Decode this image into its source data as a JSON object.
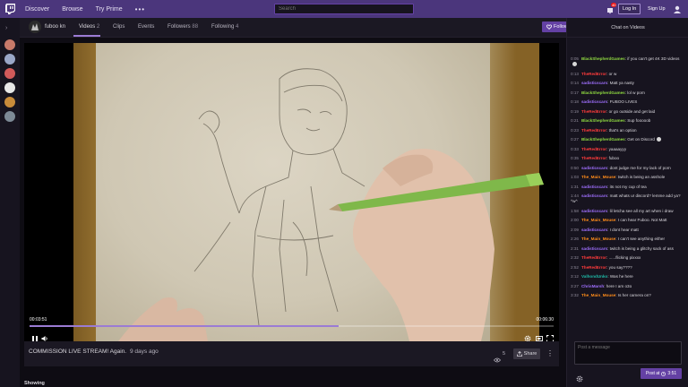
{
  "nav": {
    "items": [
      "Discover",
      "Browse",
      "Try Prime"
    ],
    "more": "•••",
    "search_placeholder": "Search",
    "notification_count": "40",
    "login": "Log In",
    "signup": "Sign Up"
  },
  "channel": {
    "name": "fuboo kn",
    "tabs": [
      {
        "label": "Videos",
        "count": "2"
      },
      {
        "label": "Clips",
        "count": ""
      },
      {
        "label": "Events",
        "count": ""
      },
      {
        "label": "Followers",
        "count": "88"
      },
      {
        "label": "Following",
        "count": "4"
      }
    ],
    "follow": "Follow"
  },
  "player": {
    "time_elapsed": "00:03:51",
    "time_total": "00:06:30",
    "progress": 0.59
  },
  "video": {
    "title": "COMMISSION LIVE STREAM! Again.",
    "age": "9 days ago",
    "views": "5",
    "share": "Share"
  },
  "showing": "Showing",
  "chat": {
    "header": "Chat on Videos",
    "placeholder": "Post a message",
    "post_label": "Post at",
    "post_time": "3:51",
    "messages": [
      {
        "time": "0:05",
        "user": "BlackShepherdGames",
        "color": "#8ed840",
        "text": ": if you can't get 4K 3D videos",
        "emote": true
      },
      {
        "time": "0:13",
        "user": "TheRedError",
        "color": "#ff3b3b",
        "text": ": or w",
        "emote": false
      },
      {
        "time": "0:14",
        "user": "sadisticscars",
        "color": "#a070ff",
        "text": ": Matt ya nasty",
        "emote": false
      },
      {
        "time": "0:17",
        "user": "BlackShepherdGames",
        "color": "#8ed840",
        "text": ": lol w porn",
        "emote": false
      },
      {
        "time": "0:18",
        "user": "sadisticscars",
        "color": "#a070ff",
        "text": ": FUBOO LIVES",
        "emote": false
      },
      {
        "time": "0:19",
        "user": "TheRedError",
        "color": "#ff3b3b",
        "text": ": or go outside and get laid",
        "emote": false
      },
      {
        "time": "0:21",
        "user": "BlackShepherdGames",
        "color": "#8ed840",
        "text": ": Sup fooooob",
        "emote": false
      },
      {
        "time": "0:23",
        "user": "TheRedError",
        "color": "#ff3b3b",
        "text": ": that's an option",
        "emote": false
      },
      {
        "time": "0:27",
        "user": "BlackShepherdGames",
        "color": "#8ed840",
        "text": ": Get on Discord",
        "emote": true
      },
      {
        "time": "0:33",
        "user": "TheRedError",
        "color": "#ff3b3b",
        "text": ": yaaaayyy",
        "emote": false
      },
      {
        "time": "0:35",
        "user": "TheRedError",
        "color": "#ff3b3b",
        "text": ": fuboo",
        "emote": false
      },
      {
        "time": "0:50",
        "user": "sadisticscars",
        "color": "#a070ff",
        "text": ": dont judge me for my lack of porn",
        "emote": false
      },
      {
        "time": "1:03",
        "user": "The_Main_Mouse",
        "color": "#ff8c1a",
        "text": ": twitch is being an asshole",
        "emote": false
      },
      {
        "time": "1:31",
        "user": "sadisticscars",
        "color": "#a070ff",
        "text": ": its not my cup of tea",
        "emote": false
      },
      {
        "time": "1:44",
        "user": "sadisticscars",
        "color": "#a070ff",
        "text": ": matt whats ur discord? lemme add ya? ^w^",
        "emote": false
      },
      {
        "time": "1:58",
        "user": "sadisticscars",
        "color": "#a070ff",
        "text": ": lil letcha see all my art when i draw",
        "emote": false
      },
      {
        "time": "2:00",
        "user": "The_Main_Mouse",
        "color": "#ff8c1a",
        "text": ": I can hear Fuboo. Not Matt",
        "emote": false
      },
      {
        "time": "2:09",
        "user": "sadisticscars",
        "color": "#a070ff",
        "text": ": I dont hear matt",
        "emote": false
      },
      {
        "time": "2:26",
        "user": "The_Main_Mouse",
        "color": "#ff8c1a",
        "text": ": I can't see anything either",
        "emote": false
      },
      {
        "time": "2:31",
        "user": "sadisticscars",
        "color": "#a070ff",
        "text": ": twitch is being a glitchy sack of ass",
        "emote": false
      },
      {
        "time": "2:32",
        "user": "TheRedError",
        "color": "#ff3b3b",
        "text": ": ......flicking pixxxx",
        "emote": false
      },
      {
        "time": "2:52",
        "user": "TheRedError",
        "color": "#ff3b3b",
        "text": ": you say????",
        "emote": false
      },
      {
        "time": "3:12",
        "user": "ValhondUnko",
        "color": "#1fb8a6",
        "text": ": Was he here",
        "emote": false
      },
      {
        "time": "3:27",
        "user": "ChrisMarsh",
        "color": "#a070ff",
        "text": ": here I am o3o",
        "emote": false
      },
      {
        "time": "3:32",
        "user": "The_Main_Mouse",
        "color": "#ff8c1a",
        "text": ": Is her camera on?",
        "emote": false
      }
    ]
  }
}
